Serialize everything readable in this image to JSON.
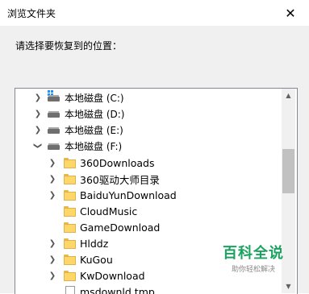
{
  "window": {
    "title": "浏览文件夹",
    "close_glyph": "✕"
  },
  "instruction": "请选择要恢复到的位置：",
  "tree": {
    "drives": [
      {
        "label": "本地磁盘 (C:)",
        "icon": "windows-drive-icon",
        "expanded": false
      },
      {
        "label": "本地磁盘 (D:)",
        "icon": "drive-icon",
        "expanded": false
      },
      {
        "label": "本地磁盘 (E:)",
        "icon": "drive-icon",
        "expanded": false
      },
      {
        "label": "本地磁盘 (F:)",
        "icon": "drive-icon",
        "expanded": true
      }
    ],
    "folders": [
      {
        "label": "360Downloads",
        "has_children": true
      },
      {
        "label": "360驱动大师目录",
        "has_children": true
      },
      {
        "label": "BaiduYunDownload",
        "has_children": true
      },
      {
        "label": "CloudMusic",
        "has_children": false
      },
      {
        "label": "GameDownload",
        "has_children": false
      },
      {
        "label": "Hlddz",
        "has_children": true
      },
      {
        "label": "KuGou",
        "has_children": true
      },
      {
        "label": "KwDownload",
        "has_children": true
      },
      {
        "label": "msdownld.tmp",
        "has_children": false
      }
    ]
  },
  "watermark": {
    "brand": "百科全说",
    "tagline": "助你轻松解决"
  }
}
